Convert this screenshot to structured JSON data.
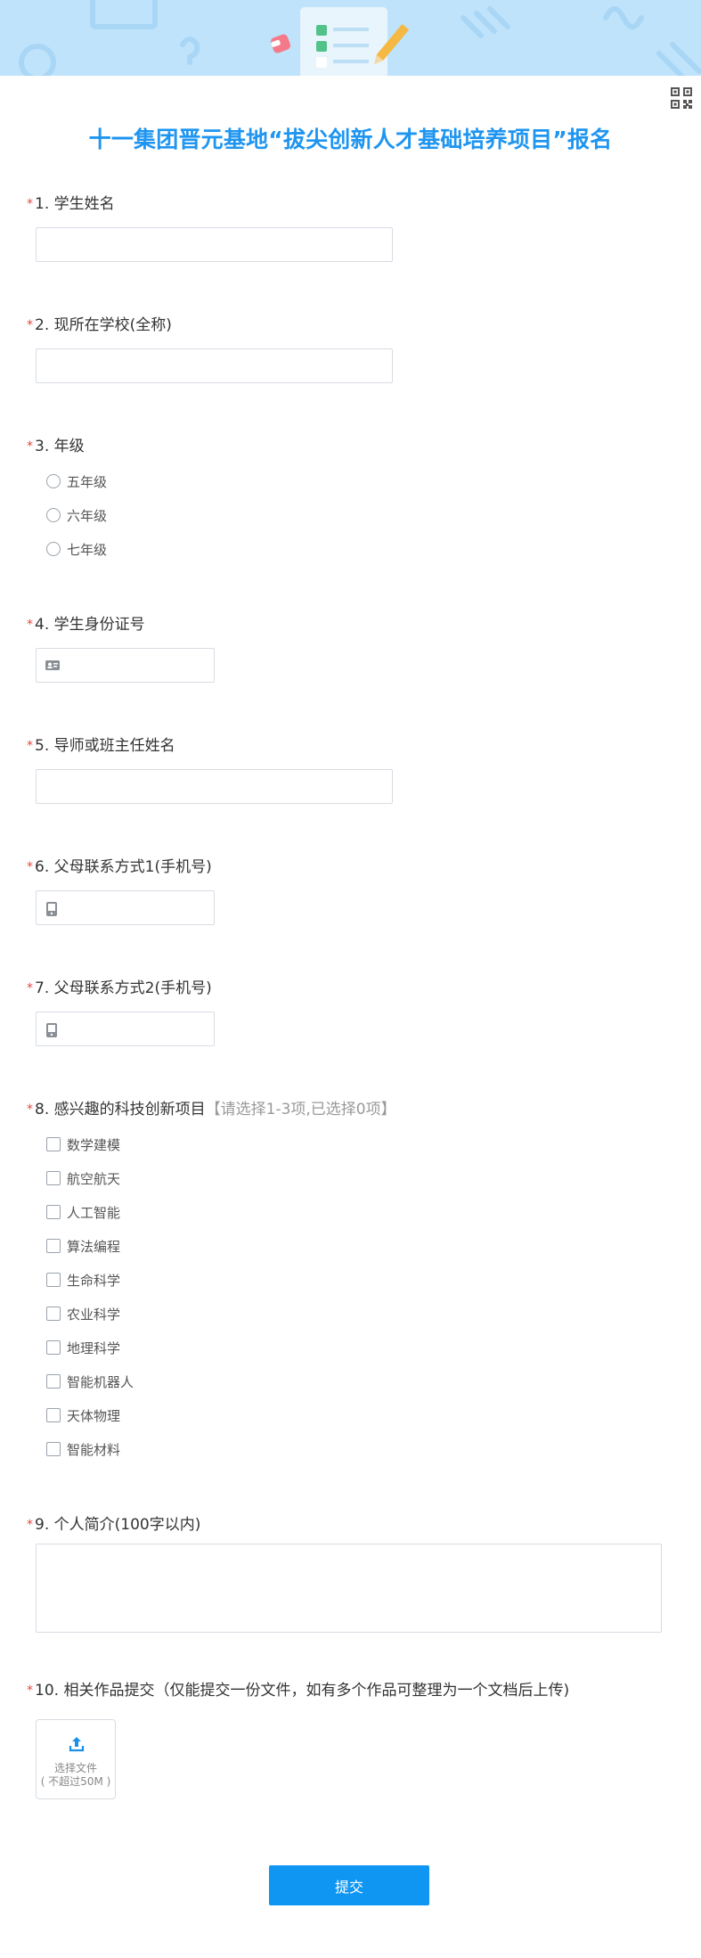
{
  "form": {
    "title": "十一集团晋元基地“拔尖创新人才基础培养项目”报名",
    "required_mark": "*",
    "submit_label": "提交"
  },
  "questions": [
    {
      "label": "1. 学生姓名",
      "type": "text"
    },
    {
      "label": "2. 现所在学校(全称)",
      "type": "text"
    },
    {
      "label": "3. 年级",
      "type": "radio",
      "options": [
        "五年级",
        "六年级",
        "七年级"
      ]
    },
    {
      "label": "4. 学生身份证号",
      "type": "id-card",
      "icon": "id-card-icon"
    },
    {
      "label": "5. 导师或班主任姓名",
      "type": "text"
    },
    {
      "label": "6. 父母联系方式1(手机号)",
      "type": "phone",
      "icon": "mobile-phone-icon"
    },
    {
      "label": "7. 父母联系方式2(手机号)",
      "type": "phone",
      "icon": "mobile-phone-icon"
    },
    {
      "label": "8. 感兴趣的科技创新项目",
      "hint": "【请选择1-3项,已选择0项】",
      "type": "checkbox",
      "options": [
        "数学建模",
        "航空航天",
        "人工智能",
        "算法编程",
        "生命科学",
        "农业科学",
        "地理科学",
        "智能机器人",
        "天体物理",
        "智能材料"
      ]
    },
    {
      "label": "9. 个人简介(100字以内)",
      "type": "textarea"
    },
    {
      "label": "10. 相关作品提交（仅能提交一份文件，如有多个作品可整理为一个文档后上传)",
      "type": "file",
      "upload_text": "选择文件",
      "upload_limit": "( 不超过50M )",
      "icon": "upload-icon"
    }
  ],
  "colors": {
    "accent": "#0e96f2",
    "title": "#1e95f0",
    "required": "#e24a3b",
    "banner": "#bfe3fb"
  },
  "icons": [
    "qr-code-icon",
    "id-card-icon",
    "mobile-phone-icon",
    "upload-icon"
  ]
}
